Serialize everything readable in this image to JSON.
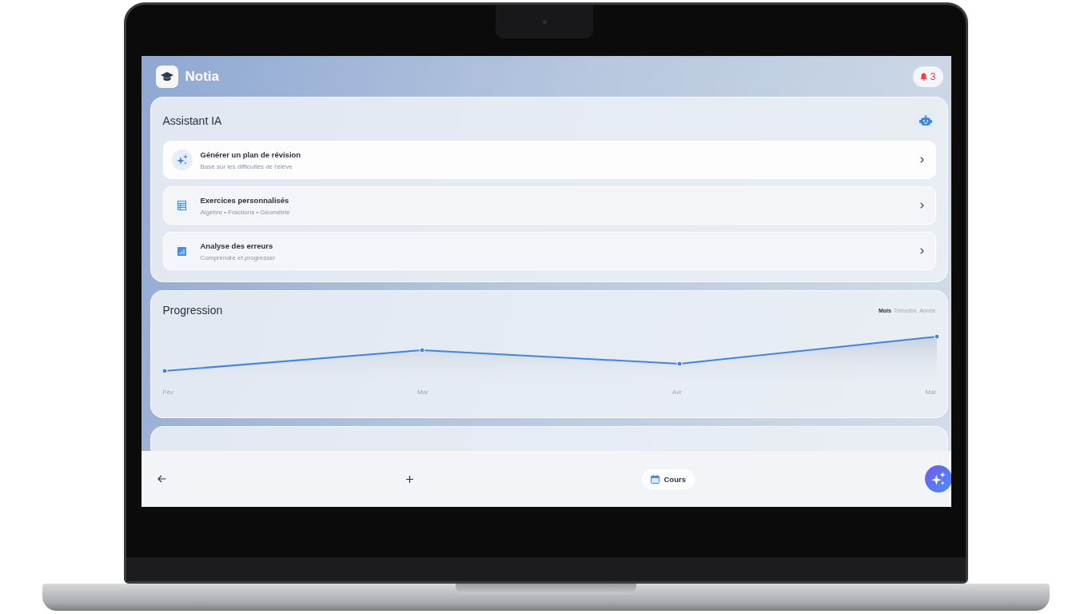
{
  "app": {
    "name": "Notia",
    "notifications": "3"
  },
  "assistant": {
    "title": "Assistant IA",
    "actions": [
      {
        "kind": "sparkle",
        "title": "Générer un plan de révision",
        "subtitle": "Basé sur les difficultés de l'élève",
        "selected": true
      },
      {
        "kind": "table",
        "title": "Exercices personnalisés",
        "subtitle": "Algèbre • Fractions • Géométrie",
        "selected": false
      },
      {
        "kind": "chart",
        "title": "Analyse des erreurs",
        "subtitle": "Comprendre et progresser",
        "selected": false
      }
    ]
  },
  "progression": {
    "title": "Progression",
    "periods": [
      {
        "label": "Mois",
        "selected": true
      },
      {
        "label": "Trimestre",
        "selected": false
      },
      {
        "label": "Année",
        "selected": false
      }
    ],
    "x_labels": [
      "Fév",
      "Mar",
      "Avr",
      "Mai"
    ]
  },
  "bottom_bar": {
    "course_button": "Cours"
  }
}
